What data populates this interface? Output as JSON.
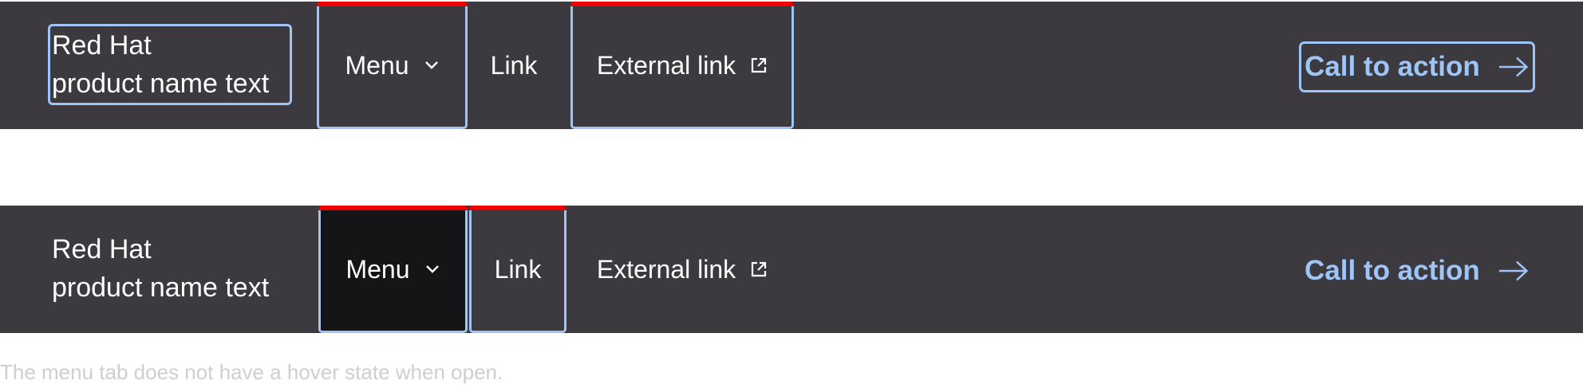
{
  "navbars": [
    {
      "brand": {
        "line1": "Red Hat",
        "line2": "product name text"
      },
      "menu_label": "Menu",
      "link_label": "Link",
      "external_link_label": "External link",
      "cta_label": "Call to action"
    },
    {
      "brand": {
        "line1": "Red Hat",
        "line2": "product name text"
      },
      "menu_label": "Menu",
      "link_label": "Link",
      "external_link_label": "External link",
      "cta_label": "Call to action"
    }
  ],
  "caption": "The menu tab does not have a hover state when open.",
  "colors": {
    "bar_background": "#3c3a3e",
    "open_menu_background": "#151417",
    "focus_outline": "#9ec5f7",
    "active_indicator": "#ee0000",
    "cta_text": "#9ec5f7"
  },
  "icons": {
    "menu": "chevron-down-icon",
    "external": "external-link-icon",
    "cta": "arrow-right-icon"
  }
}
